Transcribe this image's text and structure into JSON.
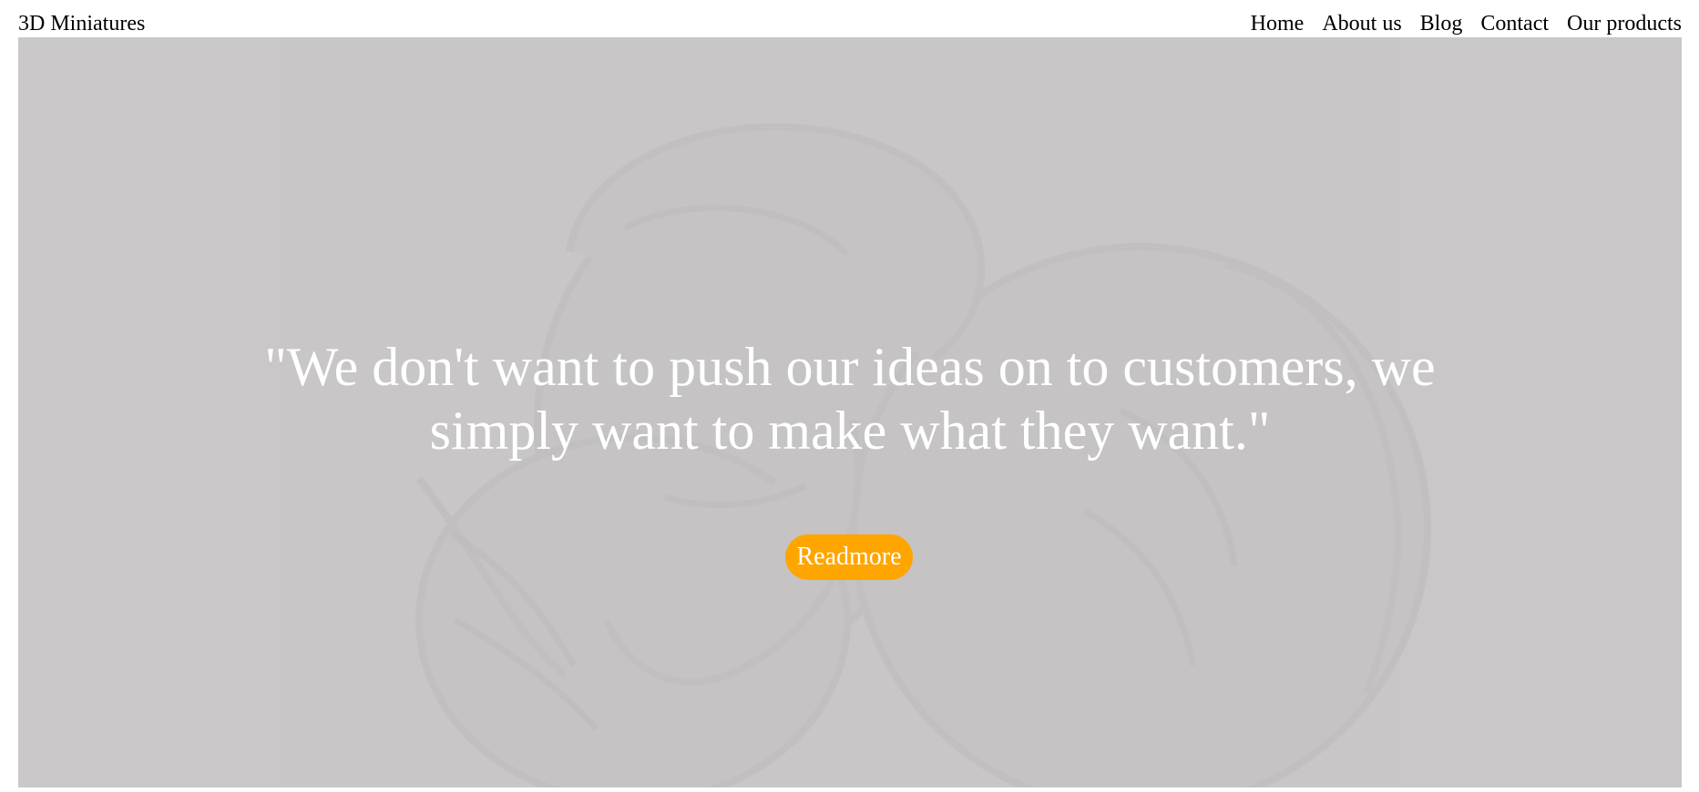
{
  "header": {
    "brand": "3D Miniatures",
    "nav": [
      "Home",
      "About us",
      "Blog",
      "Contact",
      "Our products"
    ]
  },
  "hero": {
    "background_image": "angel-statue-image",
    "quote": "\"We don't want to push our ideas on to customers, we simply want to make what they want.\"",
    "button_label": "Readmore"
  },
  "colors": {
    "hero_tint": "#c9c7c8",
    "button": "#ffa500",
    "quote_text": "#ffffff"
  }
}
